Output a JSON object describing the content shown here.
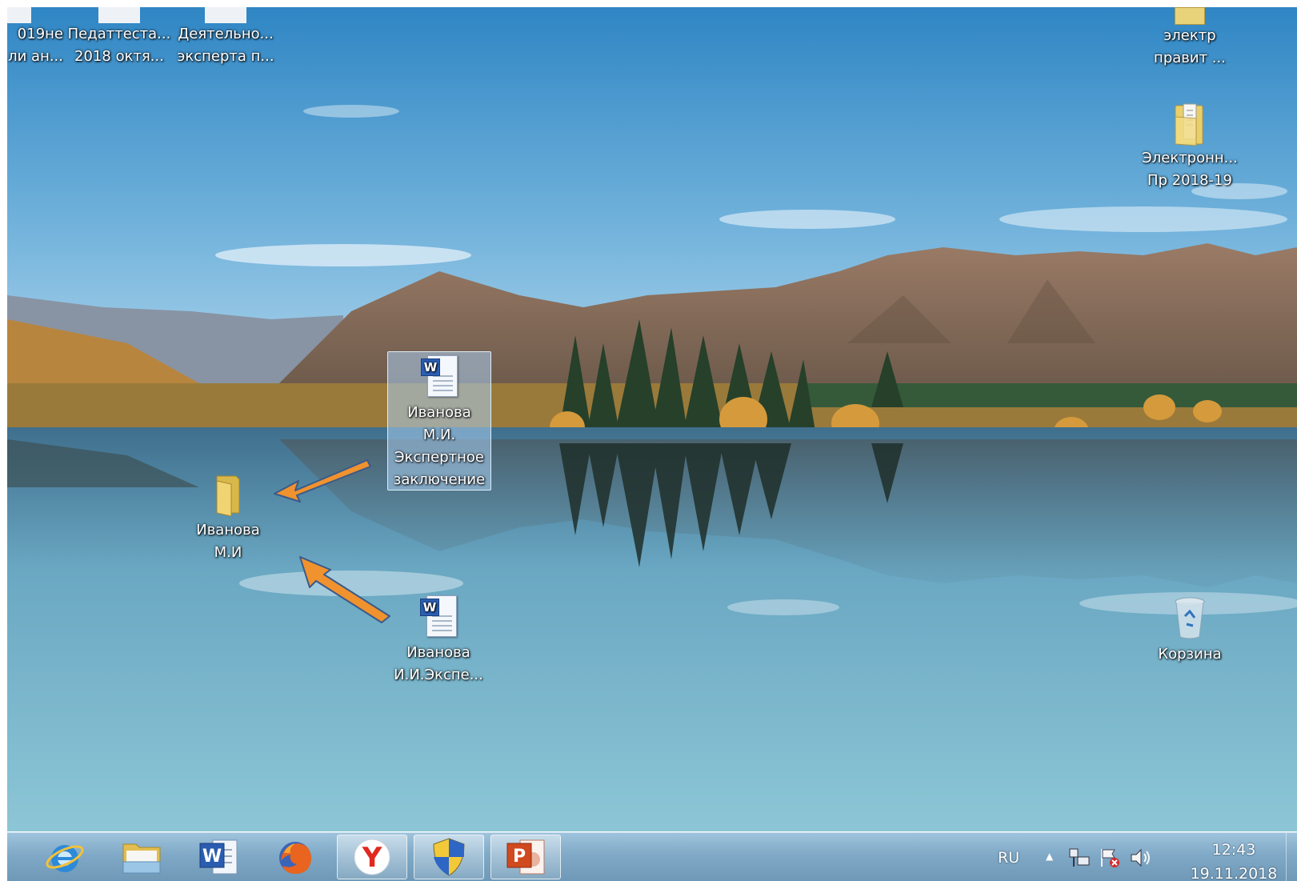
{
  "desktop_icons": {
    "partial_left": "019не\nли ан...",
    "pedattest": "Педаттеста...\n2018 октя...",
    "deyatelno": "Деятельно...\nэксперта п...",
    "elektr": "электр\nправит ...",
    "elektronn": "Электронн...\nПр 2018-19",
    "selected_doc": "Иванова\nМ.И.\nЭкспертное\nзаключение",
    "folder": "Иванова\nМ.И",
    "doc2": "Иванова\nИ.И.Экспе...",
    "recycle": "Корзина"
  },
  "taskbar": {
    "apps": [
      "internet-explorer-icon",
      "explorer-icon",
      "word-icon",
      "firefox-icon",
      "yandex-icon",
      "security-icon",
      "powerpoint-icon"
    ],
    "word_letter": "W",
    "ppt_letter": "P",
    "yandex_letter": "Y"
  },
  "tray": {
    "language": "RU",
    "time": "12:43",
    "date": "19.11.2018"
  },
  "colors": {
    "arrow": "#f0922e",
    "taskbar": "#7fa9c6",
    "selection": "#aacdf0"
  }
}
